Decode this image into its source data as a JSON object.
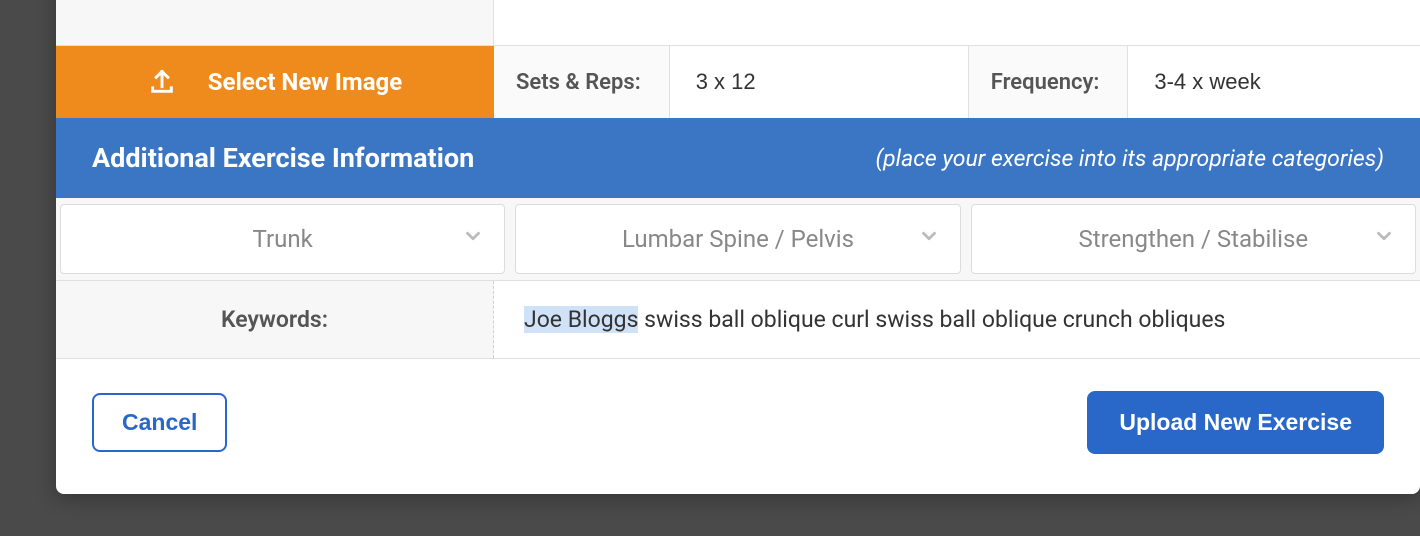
{
  "select_image_button": "Select New Image",
  "params": {
    "sets_reps_label": "Sets & Reps:",
    "sets_reps_value": "3 x 12",
    "frequency_label": "Frequency:",
    "frequency_value": "3-4 x week"
  },
  "section": {
    "title": "Additional Exercise Information",
    "help": "(place your exercise into its appropriate categories)"
  },
  "dropdowns": {
    "category1": "Trunk",
    "category2": "Lumbar Spine / Pelvis",
    "category3": "Strengthen / Stabilise"
  },
  "keywords": {
    "label": "Keywords:",
    "highlighted": "Joe Bloggs",
    "rest": " swiss ball oblique curl swiss ball oblique crunch obliques"
  },
  "footer": {
    "cancel": "Cancel",
    "upload": "Upload New Exercise"
  }
}
